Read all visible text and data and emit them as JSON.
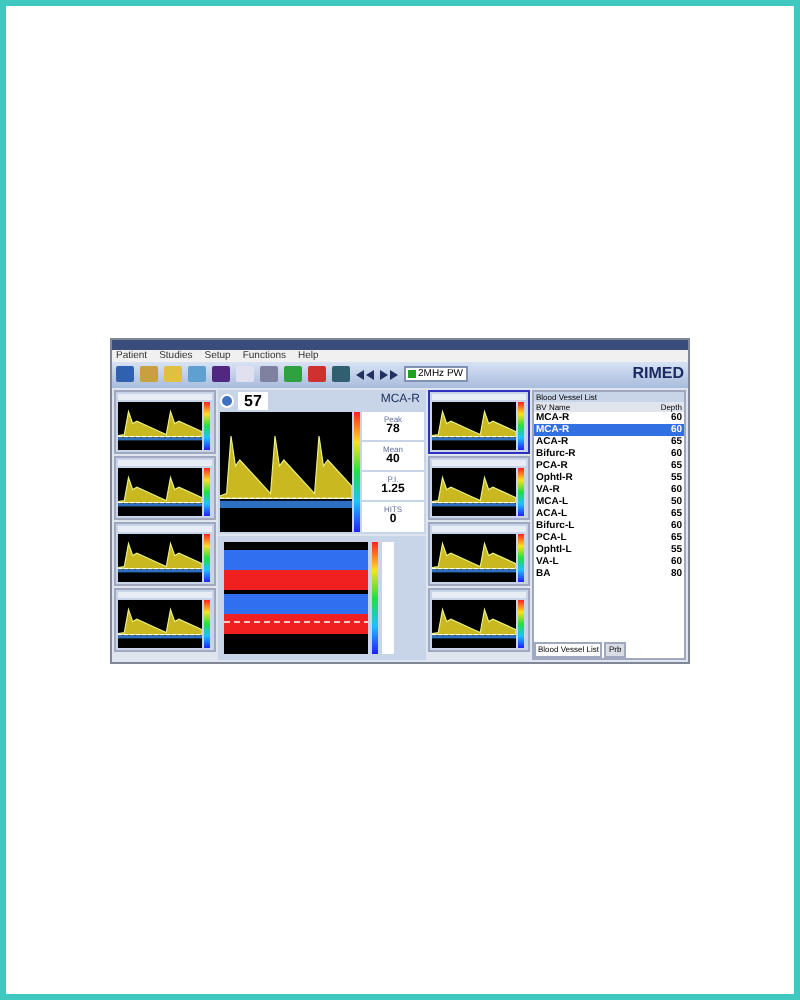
{
  "menu": [
    "Patient",
    "Studies",
    "Setup",
    "Functions",
    "Help"
  ],
  "toolbar": {
    "mode": "2MHz PW",
    "logo": "RIMED"
  },
  "main_panel": {
    "depth": "57",
    "vessel": "MCA-R",
    "stats": [
      {
        "label": "Peak",
        "value": "78"
      },
      {
        "label": "Mean",
        "value": "40"
      },
      {
        "label": "P.I.",
        "value": "1.25"
      },
      {
        "label": "HITS",
        "value": "0"
      }
    ]
  },
  "vessel_list": {
    "title": "Blood Vessel List",
    "columns": [
      "BV Name",
      "Depth"
    ],
    "rows": [
      {
        "name": "MCA-R",
        "depth": "60",
        "selected": false
      },
      {
        "name": "MCA-R",
        "depth": "60",
        "selected": true
      },
      {
        "name": "ACA-R",
        "depth": "65",
        "selected": false
      },
      {
        "name": "Bifurc-R",
        "depth": "60",
        "selected": false
      },
      {
        "name": "PCA-R",
        "depth": "65",
        "selected": false
      },
      {
        "name": "Ophtl-R",
        "depth": "55",
        "selected": false
      },
      {
        "name": "VA-R",
        "depth": "60",
        "selected": false
      },
      {
        "name": "MCA-L",
        "depth": "50",
        "selected": false
      },
      {
        "name": "ACA-L",
        "depth": "65",
        "selected": false
      },
      {
        "name": "Bifurc-L",
        "depth": "60",
        "selected": false
      },
      {
        "name": "PCA-L",
        "depth": "65",
        "selected": false
      },
      {
        "name": "Ophtl-L",
        "depth": "55",
        "selected": false
      },
      {
        "name": "VA-L",
        "depth": "60",
        "selected": false
      },
      {
        "name": "BA",
        "depth": "80",
        "selected": false
      }
    ],
    "tabs": [
      {
        "label": "Blood Vessel List",
        "selected": true
      },
      {
        "label": "Prb",
        "selected": false
      }
    ]
  }
}
